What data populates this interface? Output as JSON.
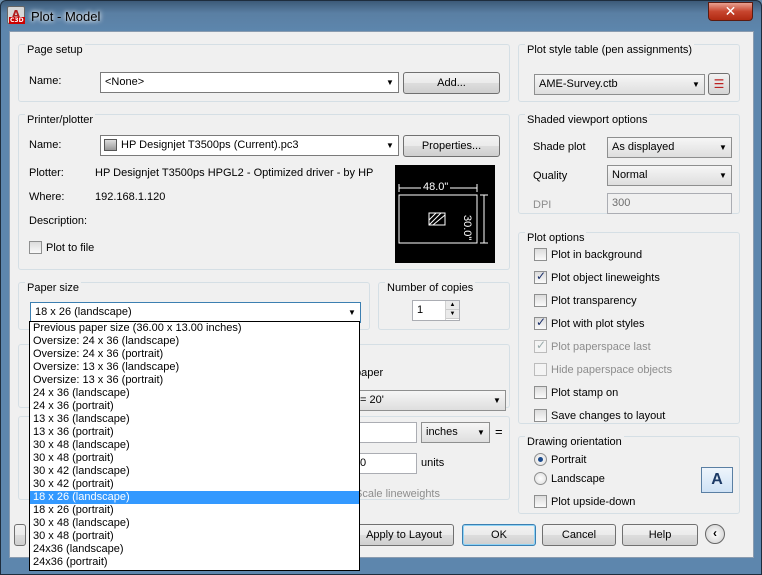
{
  "window": {
    "title": "Plot - Model",
    "close_label": "✕",
    "app_icon_letter": "A",
    "app_icon_sub": "C3D"
  },
  "page_setup": {
    "title": "Page setup",
    "name_label": "Name:",
    "name_value": "<None>",
    "add_button": "Add..."
  },
  "printer": {
    "title": "Printer/plotter",
    "name_label": "Name:",
    "name_value": "HP Designjet T3500ps (Current).pc3",
    "properties_button": "Properties...",
    "plotter_label": "Plotter:",
    "plotter_value": "HP Designjet T3500ps HPGL2 - Optimized driver - by HP",
    "where_label": "Where:",
    "where_value": "192.168.1.120",
    "description_label": "Description:",
    "plot_to_file": "Plot to file",
    "plot_to_file_checked": false,
    "preview_width": "48.0\"",
    "preview_height": "30.0\""
  },
  "paper_size": {
    "title": "Paper size",
    "selected": "18 x 26 (landscape)",
    "options": [
      "Previous paper size  (36.00 x 13.00 inches)",
      "Oversize: 24 x 36 (landscape)",
      "Oversize: 24 x 36 (portrait)",
      "Oversize: 13 x 36 (landscape)",
      "Oversize: 13 x 36 (portrait)",
      "24 x 36 (landscape)",
      "24 x 36 (portrait)",
      "13 x 36 (landscape)",
      "13 x 36 (portrait)",
      "30 x 48 (landscape)",
      "30 x 48 (portrait)",
      "30 x 42 (landscape)",
      "30 x 42 (portrait)",
      "18 x 26 (landscape)",
      "18 x 26 (portrait)",
      "30 x 48 (landscape)",
      "30 x 48 (portrait)",
      "24x36 (landscape)",
      "24x36 (portrait)"
    ],
    "selected_index": 13
  },
  "copies": {
    "title": "Number of copies",
    "value": "1"
  },
  "partial": {
    "paper_text": "paper",
    "scale_value": "= 20'",
    "units_dropdown": "inches",
    "equals": "=",
    "units_value": "0",
    "units_label": "units",
    "scale_lineweights": "Scale lineweights"
  },
  "plot_style_table": {
    "title": "Plot style table (pen assignments)",
    "value": "AME-Survey.ctb"
  },
  "shaded": {
    "title": "Shaded viewport options",
    "shade_label": "Shade plot",
    "shade_value": "As displayed",
    "quality_label": "Quality",
    "quality_value": "Normal",
    "dpi_label": "DPI",
    "dpi_value": "300"
  },
  "plot_options": {
    "title": "Plot options",
    "items": [
      {
        "label": "Plot in background",
        "checked": false,
        "disabled": false
      },
      {
        "label": "Plot object lineweights",
        "checked": true,
        "disabled": false
      },
      {
        "label": "Plot transparency",
        "checked": false,
        "disabled": false
      },
      {
        "label": "Plot with plot styles",
        "checked": true,
        "disabled": false
      },
      {
        "label": "Plot paperspace last",
        "checked": true,
        "disabled": true
      },
      {
        "label": "Hide paperspace objects",
        "checked": false,
        "disabled": true
      },
      {
        "label": "Plot stamp on",
        "checked": false,
        "disabled": false
      },
      {
        "label": "Save changes to layout",
        "checked": false,
        "disabled": false
      }
    ]
  },
  "orientation": {
    "title": "Drawing orientation",
    "portrait": "Portrait",
    "landscape": "Landscape",
    "upside_down": "Plot upside-down",
    "selected": "Portrait",
    "icon_letter": "A"
  },
  "footer": {
    "apply_button": "Apply to Layout",
    "ok_button": "OK",
    "cancel_button": "Cancel",
    "help_button": "Help",
    "expand_glyph": "‹"
  }
}
